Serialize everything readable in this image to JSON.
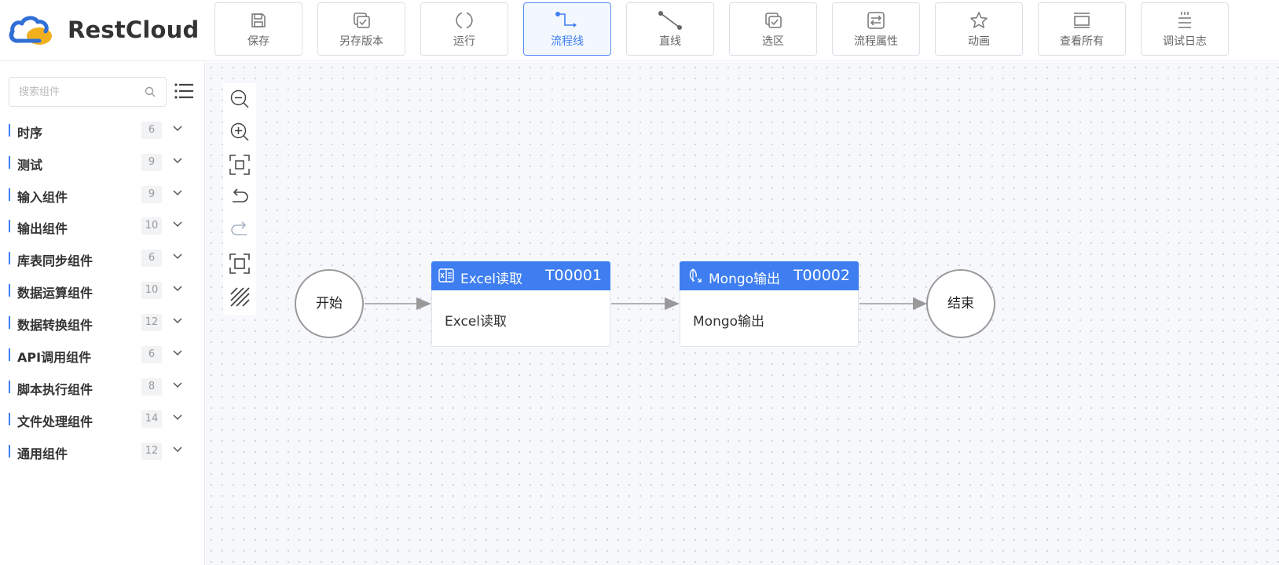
{
  "app": {
    "logo_text": "RestCloud"
  },
  "colors": {
    "accent": "#3e7ef0",
    "logo_blue": "#2f6fd6",
    "logo_gold": "#f2b01e"
  },
  "toolbar": {
    "buttons": [
      {
        "label": "保存",
        "icon": "save-icon"
      },
      {
        "label": "另存版本",
        "icon": "save-version-icon"
      },
      {
        "label": "运行",
        "icon": "run-icon"
      },
      {
        "label": "流程线",
        "icon": "flow-line-icon",
        "active": true
      },
      {
        "label": "直线",
        "icon": "straight-line-icon"
      },
      {
        "label": "选区",
        "icon": "selection-icon"
      },
      {
        "label": "流程属性",
        "icon": "properties-icon"
      },
      {
        "label": "动画",
        "icon": "star-icon"
      },
      {
        "label": "查看所有",
        "icon": "view-all-icon"
      },
      {
        "label": "调试日志",
        "icon": "debug-log-icon"
      }
    ]
  },
  "sidebar": {
    "search": {
      "placeholder": "搜索组件",
      "value": ""
    },
    "categories": [
      {
        "name": "时序",
        "count": "6"
      },
      {
        "name": "测试",
        "count": "9"
      },
      {
        "name": "输入组件",
        "count": "9"
      },
      {
        "name": "输出组件",
        "count": "10"
      },
      {
        "name": "库表同步组件",
        "count": "6"
      },
      {
        "name": "数据运算组件",
        "count": "10"
      },
      {
        "name": "数据转换组件",
        "count": "12"
      },
      {
        "name": "API调用组件",
        "count": "6"
      },
      {
        "name": "脚本执行组件",
        "count": "8"
      },
      {
        "name": "文件处理组件",
        "count": "14"
      },
      {
        "name": "通用组件",
        "count": "12"
      }
    ]
  },
  "canvas": {
    "controls": [
      "zoom-out-icon",
      "zoom-in-icon",
      "fit-center-icon",
      "undo-icon",
      "redo-icon",
      "fit-screen-icon",
      "grid-toggle-icon"
    ],
    "nodes": {
      "start": {
        "label": "开始"
      },
      "task1": {
        "title": "Excel读取",
        "id": "T00001",
        "body": "Excel读取",
        "icon": "excel-icon"
      },
      "task2": {
        "title": "Mongo输出",
        "id": "T00002",
        "body": "Mongo输出",
        "icon": "mongo-icon"
      },
      "end": {
        "label": "结束"
      }
    }
  }
}
